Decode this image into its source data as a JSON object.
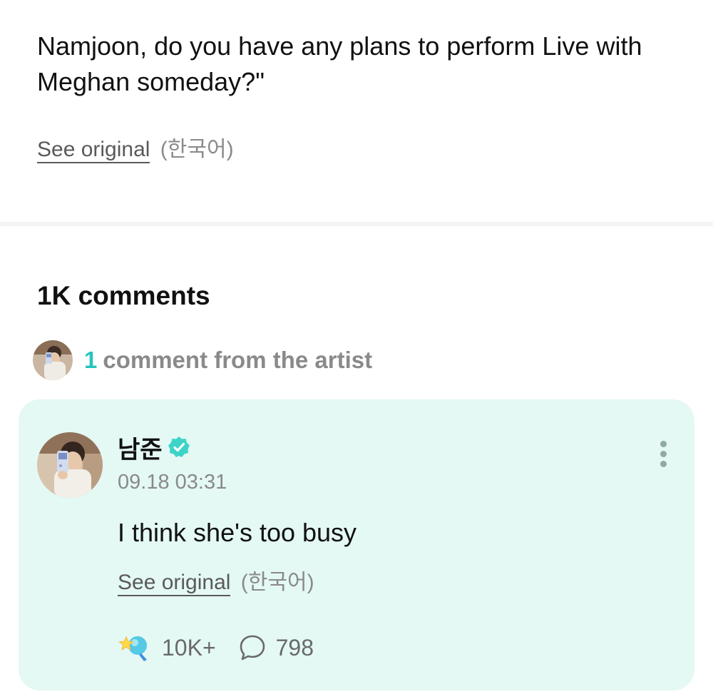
{
  "post": {
    "body": "Namjoon, do you have any plans to perform Live with Meghan someday?\"",
    "see_original_label": "See original",
    "language_tag": "(한국어)"
  },
  "comments_section": {
    "heading": "1K comments",
    "artist_summary": {
      "count": "1",
      "text": "comment from the artist"
    }
  },
  "artist_comment": {
    "author": "남준",
    "timestamp": "09.18 03:31",
    "text": "I think she's too busy",
    "see_original_label": "See original",
    "language_tag": "(한국어)",
    "like_count": "10K+",
    "reply_count": "798"
  },
  "icons": {
    "avatar": "artist-avatar",
    "verified": "verified-badge-icon",
    "more": "more-vertical-icon",
    "like": "star-like-icon",
    "reply": "speech-bubble-icon"
  },
  "colors": {
    "accent": "#26c4be",
    "card_background": "#e4f8f4",
    "verified": "#3dd3c8",
    "muted_text": "#8a8a8a"
  }
}
